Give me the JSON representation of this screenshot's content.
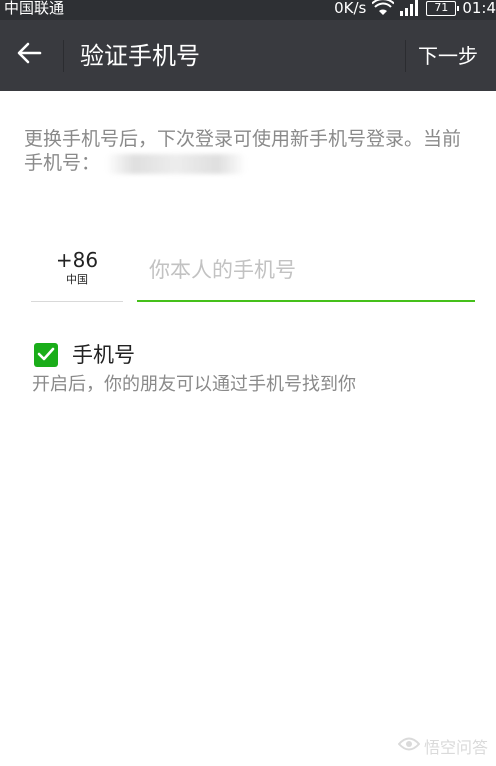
{
  "status_bar": {
    "carrier": "中国联通",
    "speed": "0K/s",
    "battery": "71",
    "time": "01:4"
  },
  "app_bar": {
    "title": "验证手机号",
    "next_label": "下一步"
  },
  "description": {
    "text": "更换手机号后，下次登录可使用新手机号登录。当前手机号："
  },
  "phone": {
    "country_code": "+86",
    "country_name": "中国",
    "placeholder": "你本人的手机号",
    "value": ""
  },
  "discoverable": {
    "checked": true,
    "label": "手机号",
    "hint": "开启后，你的朋友可以通过手机号找到你"
  },
  "watermark": {
    "text": "悟空问答"
  },
  "colors": {
    "app_bar": "#393a3f",
    "accent_green": "#1aad19",
    "input_underline": "#45c01a"
  }
}
